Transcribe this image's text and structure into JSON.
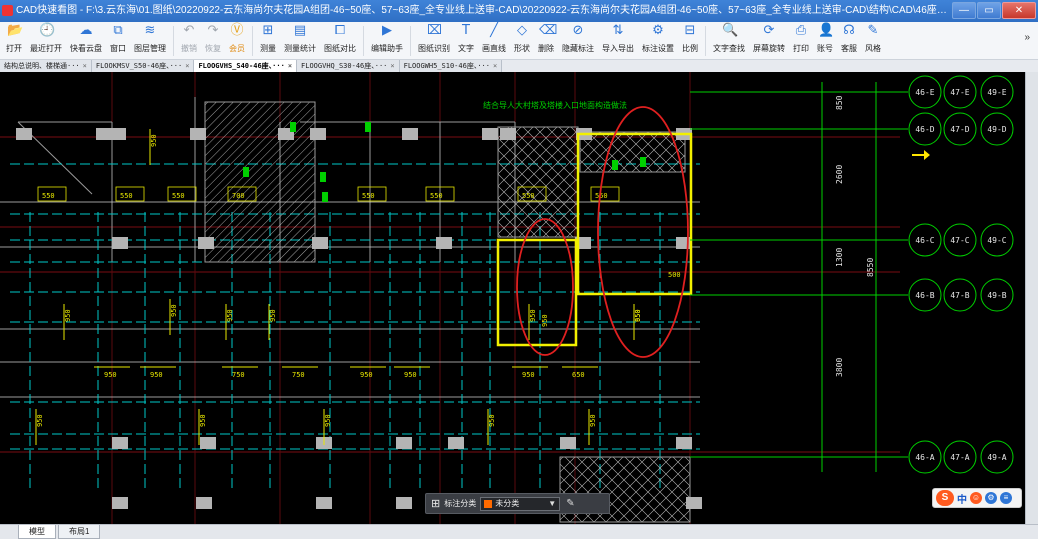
{
  "window": {
    "title": "CAD快速看图 - F:\\3.云东海\\01.图纸\\20220922-云东海尚尔夫花园A组团-46~50座、57~63座_全专业线上送审-CAD\\20220922-云东海尚尔夫花园A组团-46~50座、57~63座_全专业线上送审-CAD\\结构\\CAD\\46座、47座、49座\\FLOOGVHS_S40-46座、47座、49座_结...",
    "minimize": "—",
    "restore": "▭",
    "close": "✕"
  },
  "toolbar": {
    "items": [
      {
        "label": "打开",
        "icon": "📂",
        "name": "open"
      },
      {
        "label": "最近打开",
        "icon": "🕘",
        "name": "recent"
      },
      {
        "label": "快看云盘",
        "icon": "☁",
        "name": "cloud"
      },
      {
        "label": "窗口",
        "icon": "⧉",
        "name": "window"
      },
      {
        "label": "图层管理",
        "icon": "≋",
        "name": "layers"
      },
      {
        "label": "撤销",
        "icon": "↶",
        "name": "undo",
        "disabled": true
      },
      {
        "label": "恢复",
        "icon": "↷",
        "name": "redo",
        "disabled": true
      },
      {
        "label": "会员",
        "icon": "Ⓥ",
        "name": "vip",
        "vip": true
      },
      {
        "label": "测量",
        "icon": "⊞",
        "name": "measure"
      },
      {
        "label": "测量统计",
        "icon": "▤",
        "name": "measure-stats"
      },
      {
        "label": "图纸对比",
        "icon": "⧠",
        "name": "compare"
      },
      {
        "label": "编辑助手",
        "icon": "▶",
        "name": "edit-assistant"
      },
      {
        "label": "图纸识别",
        "icon": "⌧",
        "name": "recognize"
      },
      {
        "label": "文字",
        "icon": "T",
        "name": "text"
      },
      {
        "label": "画直线",
        "icon": "╱",
        "name": "line"
      },
      {
        "label": "形状",
        "icon": "◇",
        "name": "shape"
      },
      {
        "label": "删除",
        "icon": "⌫",
        "name": "delete"
      },
      {
        "label": "隐藏标注",
        "icon": "⊘",
        "name": "hide-annotation"
      },
      {
        "label": "导入导出",
        "icon": "⇅",
        "name": "import-export"
      },
      {
        "label": "标注设置",
        "icon": "⚙",
        "name": "annotation-settings"
      },
      {
        "label": "比例",
        "icon": "⊟",
        "name": "scale"
      },
      {
        "label": "文字查找",
        "icon": "🔍",
        "name": "find-text"
      },
      {
        "label": "屏幕旋转",
        "icon": "⟳",
        "name": "rotate"
      },
      {
        "label": "打印",
        "icon": "⎙",
        "name": "print"
      },
      {
        "label": "账号",
        "icon": "👤",
        "name": "account"
      },
      {
        "label": "客服",
        "icon": "☊",
        "name": "support"
      },
      {
        "label": "风格",
        "icon": "✎",
        "name": "style"
      }
    ],
    "overflow": "»"
  },
  "tabs": [
    {
      "label": "结构总说明、楼梯通···",
      "active": false
    },
    {
      "label": "FLOOKMSV_S50-46座、···",
      "active": false
    },
    {
      "label": "FLOOGVHS_S40-46座、···",
      "active": true
    },
    {
      "label": "FLOOGVHQ_S30-46座、···",
      "active": false
    },
    {
      "label": "FLOOGWH5_S10-46座、···",
      "active": false
    }
  ],
  "drawing": {
    "header_note": "结合导人大村塔及塔楼入口地面构造做法",
    "axis_bubbles": [
      [
        "46-E",
        "47-E",
        "49-E"
      ],
      [
        "46-D",
        "47-D",
        "49-D"
      ],
      [
        "46-C",
        "47-C",
        "49-C"
      ],
      [
        "46-B",
        "47-B",
        "49-B"
      ],
      [
        "46-A",
        "47-A",
        "49-A"
      ]
    ],
    "dims_right": [
      "850",
      "2600",
      "1300",
      "8550",
      "3800"
    ],
    "dims_top": [
      "550",
      "550",
      "550",
      "700",
      "550",
      "550",
      "550",
      "550"
    ],
    "dims_mid": [
      "950",
      "950",
      "750",
      "750",
      "950",
      "950",
      "950",
      "650"
    ],
    "dims_vertical": [
      "950",
      "950",
      "950",
      "950",
      "950",
      "950",
      "950",
      "950",
      "950",
      "950",
      "950",
      "950"
    ],
    "box_labels": [
      "500",
      "950",
      "650"
    ]
  },
  "annotation_bar": {
    "label": "标注分类",
    "selected": "未分类",
    "swatch_color": "#ff6a00"
  },
  "ime": {
    "logo": "S",
    "mode": "中"
  },
  "layout_tabs": [
    {
      "label": "模型",
      "active": true
    },
    {
      "label": "布局1",
      "active": false
    }
  ],
  "colors": {
    "highlight_box": "#f2f000",
    "red_ellipse": "#e02020",
    "axis_line": "#00d000",
    "dim_text": "#e8e800",
    "beam_dashed": "#00c8c8"
  }
}
